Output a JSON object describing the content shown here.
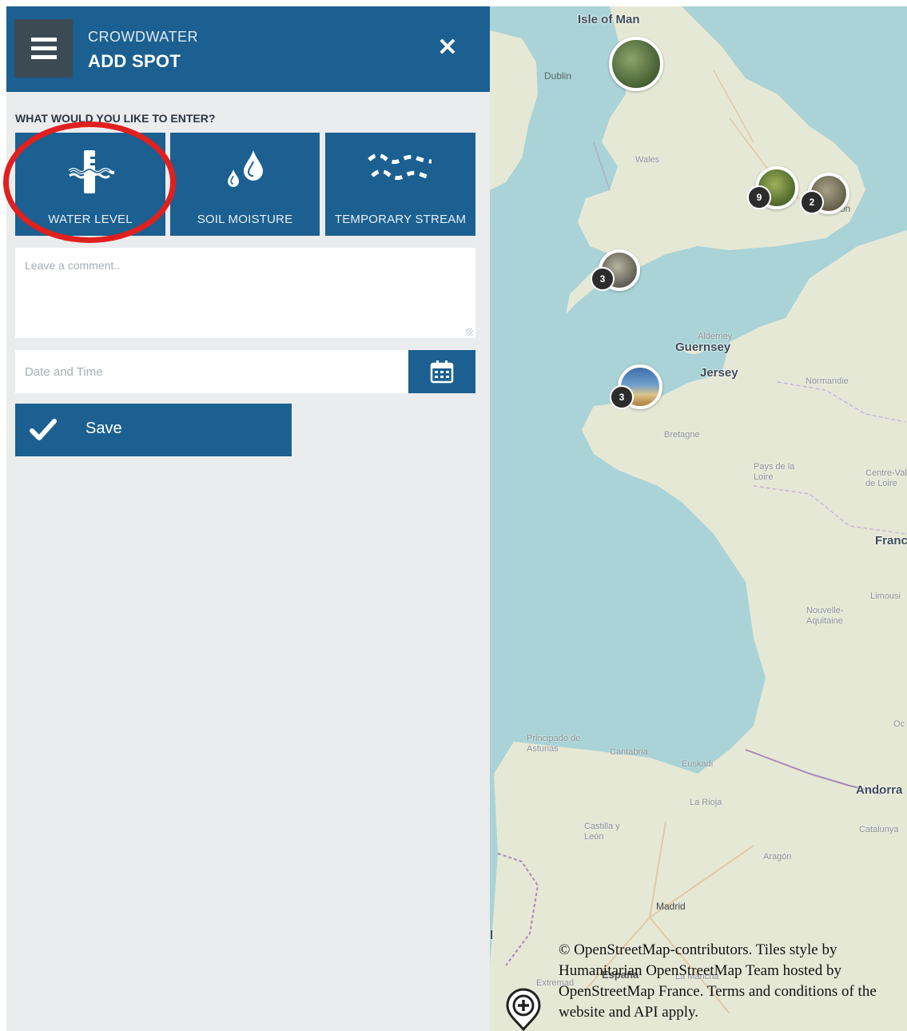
{
  "header": {
    "app_name": "CROWDWATER",
    "title": "ADD SPOT",
    "menu_icon": "hamburger-menu-icon",
    "close_icon": "close-icon"
  },
  "form": {
    "question": "WHAT WOULD YOU LIKE TO ENTER?",
    "types": [
      {
        "label": "WATER LEVEL",
        "icon": "water-level-icon",
        "highlighted": true
      },
      {
        "label": "SOIL MOISTURE",
        "icon": "soil-moisture-icon"
      },
      {
        "label": "TEMPORARY STREAM",
        "icon": "temporary-stream-icon"
      }
    ],
    "comment_placeholder": "Leave a comment..",
    "comment_value": "",
    "datetime_placeholder": "Date and Time",
    "datetime_value": "",
    "calendar_icon": "calendar-icon",
    "save_label": "Save"
  },
  "map": {
    "places": [
      "Isle of Man",
      "Dublin",
      "Wales",
      "on",
      "Alderney",
      "Guernsey",
      "Jersey",
      "Normandie",
      "Bretagne",
      "Pays de la Loire",
      "Centre-Val de Loire",
      "Franc",
      "Limousi",
      "Nouvelle-Aquitaine",
      "Oc",
      "Principado de Asturias",
      "Cantabria",
      "Euskadi",
      "Andorra",
      "La Rioja",
      "Catalunya",
      "Castilla y León",
      "Aragón",
      "Madrid",
      "España",
      "Extremad",
      "La Mancha",
      "l"
    ],
    "clusters": [
      {
        "count": ""
      },
      {
        "count": "9"
      },
      {
        "count": "2"
      },
      {
        "count": "3"
      },
      {
        "count": "3"
      }
    ],
    "attribution": "© OpenStreetMap-contributors. Tiles style by Humanitarian OpenStreetMap Team hosted by OpenStreetMap France. Terms and conditions of the website and API apply.",
    "add_icon": "add-spot-marker-icon",
    "colors": {
      "sea": "#a9d3d6",
      "land": "#e6e8d6"
    }
  },
  "colors": {
    "primary": "#1b6090",
    "menu_button": "#3c4a54",
    "highlight": "#e0201e",
    "sidebar_bg": "#eaecee"
  }
}
